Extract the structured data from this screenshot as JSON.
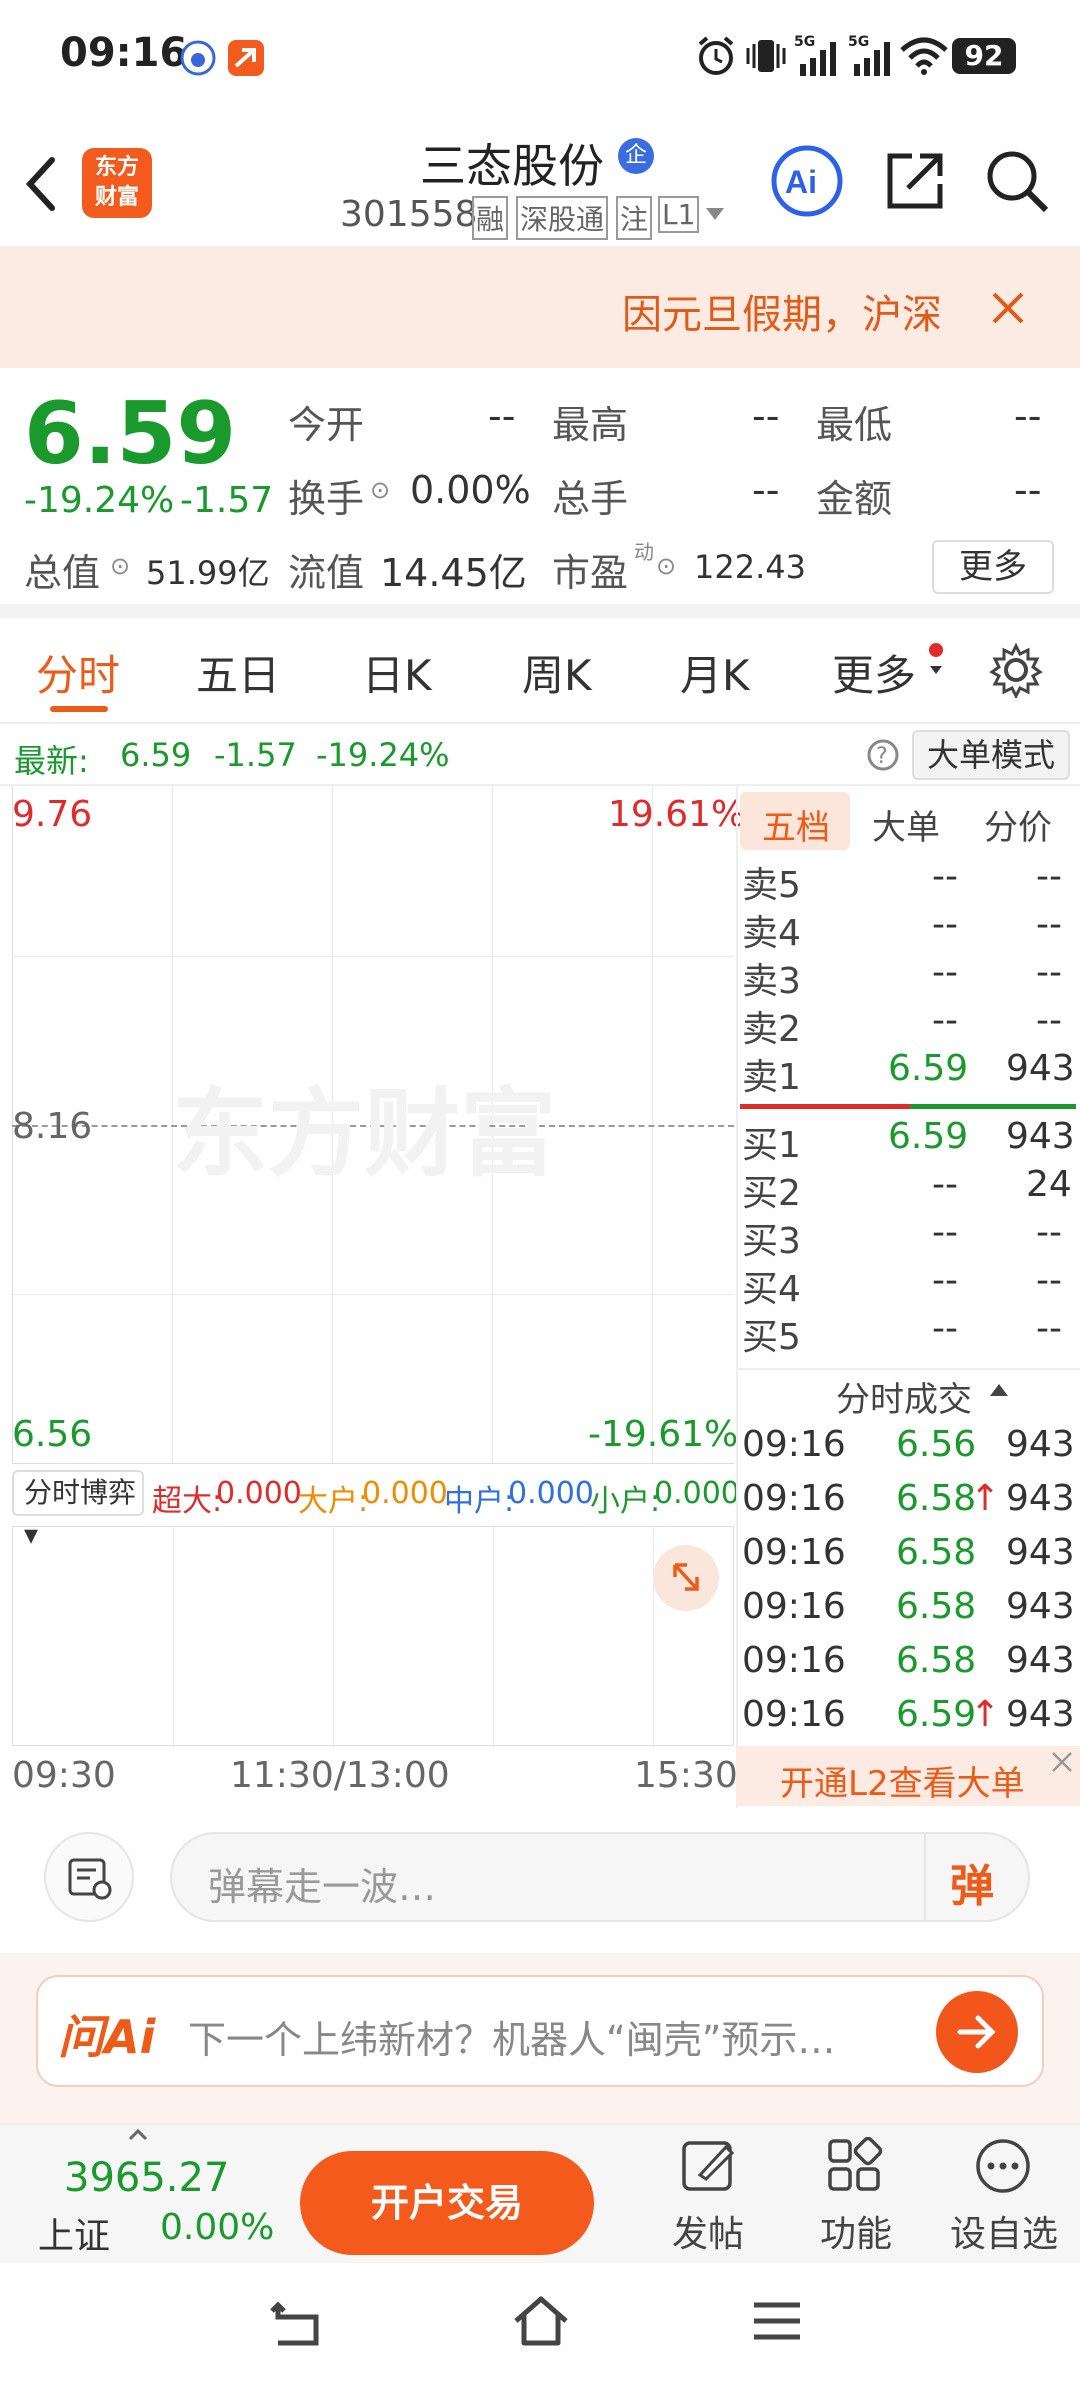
{
  "status": {
    "time": "09:16",
    "battery": "92"
  },
  "header": {
    "logo_line1": "东方",
    "logo_line2": "财富",
    "name": "三态股份",
    "name_badge": "企",
    "code": "301558",
    "tag_rong": "融",
    "tag_sgt": "深股通",
    "tag_zhu": "注",
    "tag_l1": "L1"
  },
  "notice": {
    "text": "因元旦假期，沪深"
  },
  "quote": {
    "price": "6.59",
    "change_pct": "-19.24%",
    "change": "-1.57",
    "total_value_label": "总值",
    "total_value": "51.99亿",
    "open_label": "今开",
    "open": "--",
    "high_label": "最高",
    "high": "--",
    "low_label": "最低",
    "low": "--",
    "turnover_label": "换手",
    "turnover": "0.00%",
    "volume_label": "总手",
    "volume": "--",
    "amount_label": "金额",
    "amount": "--",
    "float_label": "流值",
    "float": "14.45亿",
    "pe_label": "市盈",
    "pe_sup": "动",
    "pe": "122.43",
    "more": "更多"
  },
  "tabs": [
    "分时",
    "五日",
    "日K",
    "周K",
    "月K",
    "更多"
  ],
  "lastbar": {
    "label": "最新:",
    "price": "6.59",
    "change": "-1.57",
    "pct": "-19.24%",
    "mode_button": "大单模式"
  },
  "chart": {
    "y_top": "9.76",
    "y_top_pct": "19.61%",
    "y_mid": "8.16",
    "y_bottom": "6.56",
    "y_bottom_pct": "-19.61%",
    "watermark": "东方财富",
    "sub_select": "分时博弈",
    "super_label": "超大:",
    "super_val": "0.000",
    "big_label": "大户:",
    "big_val": "0.000",
    "mid_label": "中户:",
    "mid_val": "0.000",
    "small_label": "小户:",
    "small_val": "0.000",
    "x_start": "09:30",
    "x_mid": "11:30/13:00",
    "x_end": "15:30"
  },
  "book_tabs": [
    "五档",
    "大单",
    "分价"
  ],
  "asks": [
    {
      "label": "卖5",
      "price": "--",
      "vol": "--"
    },
    {
      "label": "卖4",
      "price": "--",
      "vol": "--"
    },
    {
      "label": "卖3",
      "price": "--",
      "vol": "--"
    },
    {
      "label": "卖2",
      "price": "--",
      "vol": "--"
    },
    {
      "label": "卖1",
      "price": "6.59",
      "vol": "943"
    }
  ],
  "bids": [
    {
      "label": "买1",
      "price": "6.59",
      "vol": "943"
    },
    {
      "label": "买2",
      "price": "--",
      "vol": "24"
    },
    {
      "label": "买3",
      "price": "--",
      "vol": "--"
    },
    {
      "label": "买4",
      "price": "--",
      "vol": "--"
    },
    {
      "label": "买5",
      "price": "--",
      "vol": "--"
    }
  ],
  "trades_title": "分时成交",
  "trades": [
    {
      "time": "09:16",
      "price": "6.56",
      "arrow": "",
      "vol": "943"
    },
    {
      "time": "09:16",
      "price": "6.58",
      "arrow": "↑",
      "vol": "943"
    },
    {
      "time": "09:16",
      "price": "6.58",
      "arrow": "",
      "vol": "943"
    },
    {
      "time": "09:16",
      "price": "6.58",
      "arrow": "",
      "vol": "943"
    },
    {
      "time": "09:16",
      "price": "6.58",
      "arrow": "",
      "vol": "943"
    },
    {
      "time": "09:16",
      "price": "6.59",
      "arrow": "↑",
      "vol": "943"
    }
  ],
  "l2_banner": "开通L2查看大单",
  "comment": {
    "placeholder": "弹幕走一波…",
    "danmu": "弹"
  },
  "askai": {
    "logo": "问Ai",
    "text": "下一个上纬新材？机器人“闽壳”预示…"
  },
  "tabbar": {
    "index_value": "3965.27",
    "index_name": "上证",
    "index_pct": "0.00%",
    "trade_button": "开户交易",
    "post": "发帖",
    "func": "功能",
    "watch": "设自选"
  }
}
